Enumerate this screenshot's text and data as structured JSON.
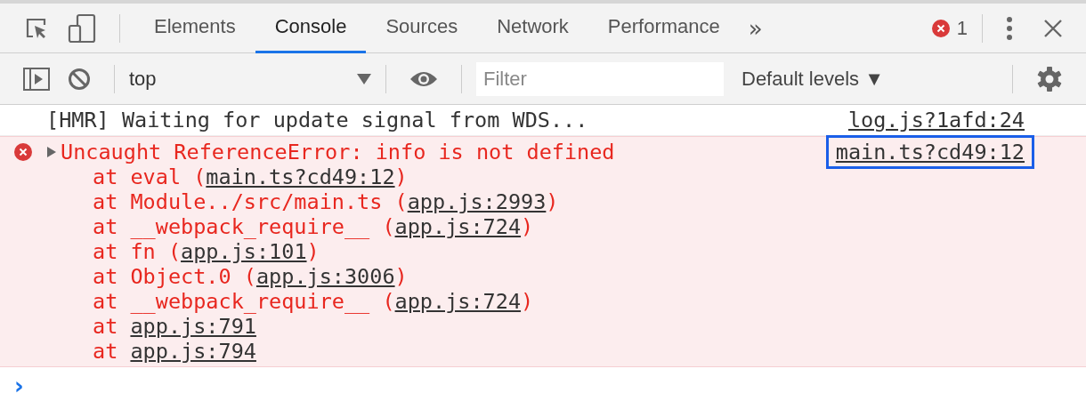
{
  "tabs": [
    {
      "label": "Elements",
      "selected": false
    },
    {
      "label": "Console",
      "selected": true
    },
    {
      "label": "Sources",
      "selected": false
    },
    {
      "label": "Network",
      "selected": false
    },
    {
      "label": "Performance",
      "selected": false
    }
  ],
  "more_tabs": "»",
  "error_count": "1",
  "toolbar": {
    "context": "top",
    "filter": {
      "placeholder": "Filter"
    },
    "levels": "Default levels ▼"
  },
  "messages": [
    {
      "kind": "log",
      "text": "[HMR] Waiting for update signal from WDS...",
      "source": "log.js?1afd:24",
      "highlighted": false
    },
    {
      "kind": "error",
      "text": "Uncaught ReferenceError: info is not defined",
      "source": "main.ts?cd49:12",
      "highlighted": true,
      "stack": [
        {
          "prefix": "at eval (",
          "link": "main.ts?cd49:12",
          "suffix": ")"
        },
        {
          "prefix": "at Module../src/main.ts (",
          "link": "app.js:2993",
          "suffix": ")"
        },
        {
          "prefix": "at __webpack_require__ (",
          "link": "app.js:724",
          "suffix": ")"
        },
        {
          "prefix": "at fn (",
          "link": "app.js:101",
          "suffix": ")"
        },
        {
          "prefix": "at Object.0 (",
          "link": "app.js:3006",
          "suffix": ")"
        },
        {
          "prefix": "at __webpack_require__ (",
          "link": "app.js:724",
          "suffix": ")"
        },
        {
          "prefix": "at ",
          "link": "app.js:791"
        },
        {
          "prefix": "at ",
          "link": "app.js:794"
        }
      ]
    }
  ],
  "prompt": "›"
}
